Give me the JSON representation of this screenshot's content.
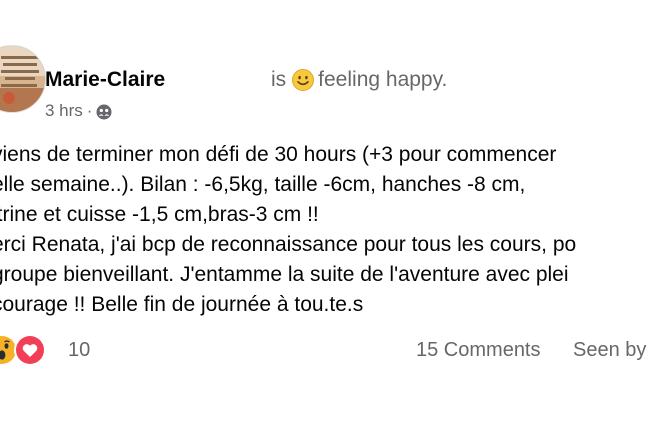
{
  "post": {
    "author_name": "Marie-Claire",
    "feeling_prefix": "is",
    "feeling_text": "feeling happy.",
    "timestamp": "3 hrs",
    "meta_separator": "·",
    "audience_icon": "friends-icon",
    "body_lines": [
      "viens de terminer mon défi de 30 hours (+3 pour commencer",
      "elle semaine..). Bilan  : -6,5kg, taille -6cm, hanches -8 cm,",
      "itrine et cuisse -1,5 cm,bras-3 cm !!",
      "erci Renata, j'ai bcp de reconnaissance pour tous les cours, po",
      "groupe bienveillant. J'entamme la suite de l'aventure avec plei",
      " courage !! Belle fin de journée à tou.te.s"
    ]
  },
  "footer": {
    "reaction_icons": [
      "wow-icon",
      "love-icon"
    ],
    "reaction_count": "10",
    "comments_label": "15 Comments",
    "seen_by_label": "Seen by"
  },
  "colors": {
    "text_primary": "#050505",
    "text_secondary": "#65676b",
    "love_red": "#f33e58",
    "wow_yellow": "#f7b125"
  }
}
